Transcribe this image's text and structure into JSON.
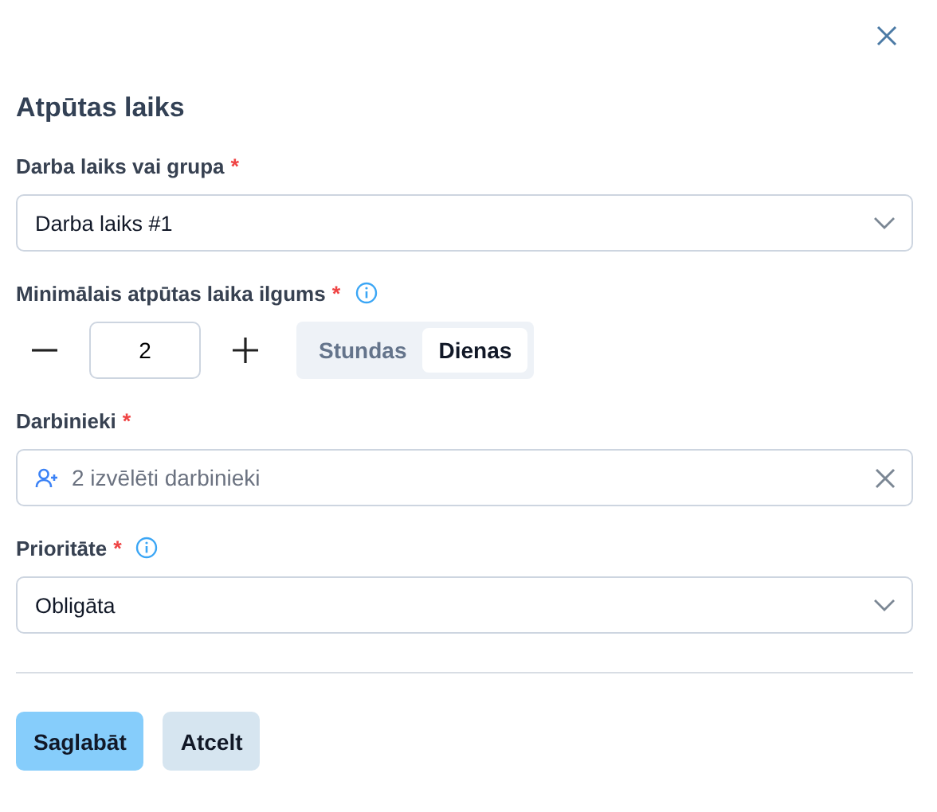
{
  "title": "Atpūtas laiks",
  "fields": [
    {
      "kind": "select",
      "label": "Darba laiks vai grupa",
      "required_mark": "*",
      "info": false,
      "value": "Darba laiks #1"
    },
    {
      "kind": "stepper",
      "label": "Minimālais atpūtas laika ilgums",
      "required_mark": "*",
      "info": true,
      "value": "2",
      "units": [
        {
          "label": "Stundas",
          "selected": false
        },
        {
          "label": "Dienas",
          "selected": true
        }
      ]
    },
    {
      "kind": "people",
      "label": "Darbinieki",
      "required_mark": "*",
      "info": false,
      "placeholder": "2 izvēlēti darbinieki"
    },
    {
      "kind": "select",
      "label": "Prioritāte",
      "required_mark": "*",
      "info": true,
      "value": "Obligāta"
    }
  ],
  "buttons": [
    {
      "label": "Saglabāt",
      "kind": "primary"
    },
    {
      "label": "Atcelt",
      "kind": "secondary"
    }
  ]
}
